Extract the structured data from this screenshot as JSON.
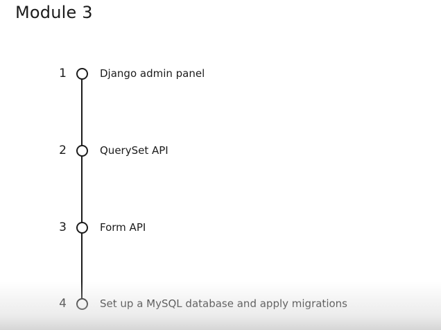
{
  "page_title": "Module 3",
  "steps": [
    {
      "number": "1",
      "label": "Django admin panel"
    },
    {
      "number": "2",
      "label": "QuerySet API"
    },
    {
      "number": "3",
      "label": "Form API"
    },
    {
      "number": "4",
      "label": "Set up a MySQL database and apply migrations"
    }
  ]
}
